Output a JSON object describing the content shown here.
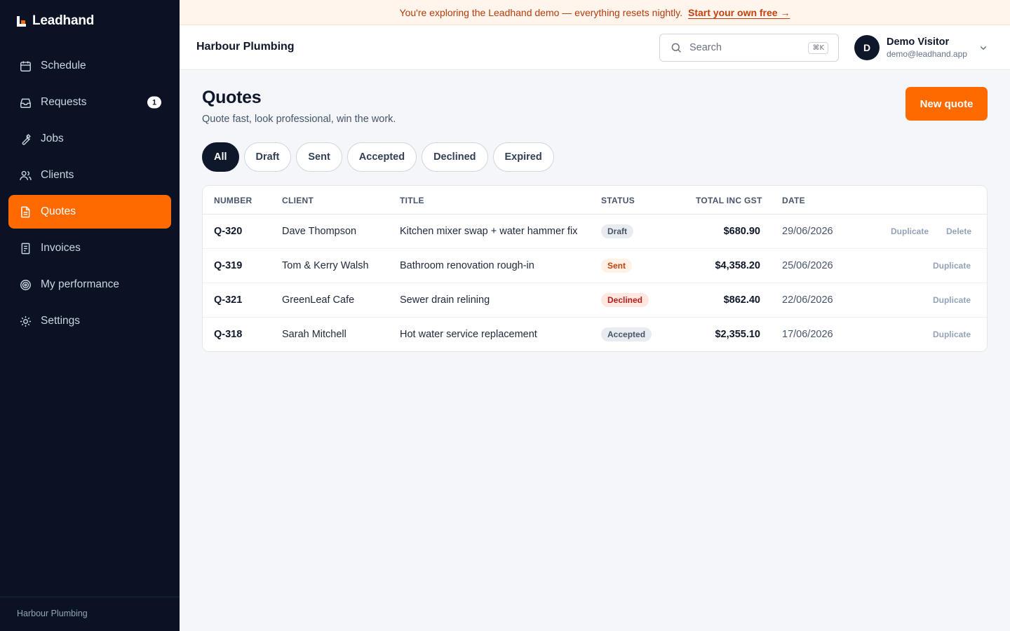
{
  "app": {
    "brand": "Leadhand",
    "accent": "#ff6a00",
    "sidebar_bg": "#0b1224"
  },
  "sidebar": {
    "items": [
      {
        "label": "Schedule",
        "icon": "calendar-icon",
        "active": false
      },
      {
        "label": "Requests",
        "icon": "inbox-icon",
        "active": false,
        "badge": "1"
      },
      {
        "label": "Jobs",
        "icon": "wrench-icon",
        "active": false
      },
      {
        "label": "Clients",
        "icon": "users-icon",
        "active": false
      },
      {
        "label": "Quotes",
        "icon": "document-icon",
        "active": true
      },
      {
        "label": "Invoices",
        "icon": "receipt-icon",
        "active": false
      },
      {
        "label": "My performance",
        "icon": "target-icon",
        "active": false
      },
      {
        "label": "Settings",
        "icon": "gear-icon",
        "active": false
      }
    ],
    "footer": "Harbour Plumbing"
  },
  "banner": {
    "text": "You're exploring the Leadhand demo — everything resets nightly.",
    "link": "Start your own free →"
  },
  "header": {
    "org": "Harbour Plumbing",
    "search_placeholder": "Search",
    "shortcut": "⌘K",
    "user": {
      "initial": "D",
      "name": "Demo Visitor",
      "email": "demo@leadhand.app"
    }
  },
  "main": {
    "title": "Quotes",
    "subtitle": "Quote fast, look professional, win the work.",
    "new_button": "New quote",
    "filters": [
      {
        "label": "All",
        "active": true
      },
      {
        "label": "Draft",
        "active": false
      },
      {
        "label": "Sent",
        "active": false
      },
      {
        "label": "Accepted",
        "active": false
      },
      {
        "label": "Declined",
        "active": false
      },
      {
        "label": "Expired",
        "active": false
      }
    ],
    "table": {
      "columns": {
        "number": "NUMBER",
        "client": "CLIENT",
        "title": "TITLE",
        "status": "STATUS",
        "total": "TOTAL INC GST",
        "date": "DATE"
      },
      "rows": [
        {
          "number": "Q-320",
          "client": "Dave Thompson",
          "title": "Kitchen mixer swap + water hammer fix",
          "status": "Draft",
          "total": "$680.90",
          "date": "29/06/2026",
          "actions": [
            "Duplicate",
            "Delete"
          ]
        },
        {
          "number": "Q-319",
          "client": "Tom & Kerry Walsh",
          "title": "Bathroom renovation rough-in",
          "status": "Sent",
          "total": "$4,358.20",
          "date": "25/06/2026",
          "actions": [
            "Duplicate"
          ]
        },
        {
          "number": "Q-321",
          "client": "GreenLeaf Cafe",
          "title": "Sewer drain relining",
          "status": "Declined",
          "total": "$862.40",
          "date": "22/06/2026",
          "actions": [
            "Duplicate"
          ]
        },
        {
          "number": "Q-318",
          "client": "Sarah Mitchell",
          "title": "Hot water service replacement",
          "status": "Accepted",
          "total": "$2,355.10",
          "date": "17/06/2026",
          "actions": [
            "Duplicate"
          ]
        }
      ]
    },
    "status_colors": {
      "Draft": {
        "bg": "#e8ebf0",
        "fg": "#475569"
      },
      "Sent": {
        "bg": "#fff1e6",
        "fg": "#c2410c"
      },
      "Declined": {
        "bg": "#fde7df",
        "fg": "#b91c1c"
      },
      "Accepted": {
        "bg": "#e8ebf0",
        "fg": "#475569"
      }
    }
  }
}
